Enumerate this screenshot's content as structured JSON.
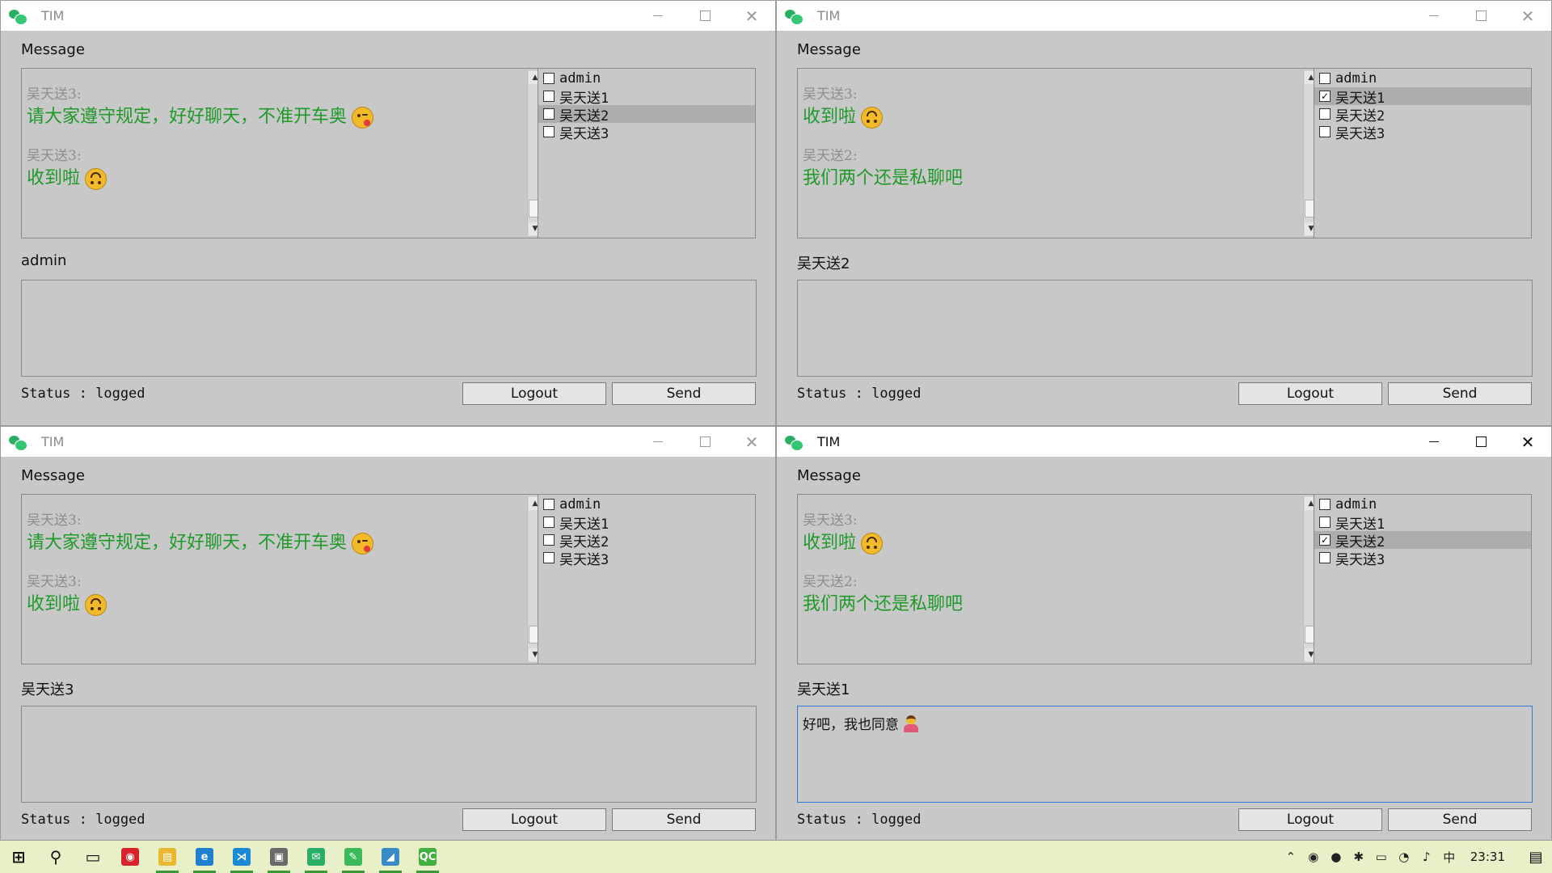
{
  "colors": {
    "window_bg": "#c8c8c8",
    "message_text": "#1f9a2a",
    "sender_text": "#8e8e8e",
    "selected_row": "#adadad",
    "focus_border": "#3078d4",
    "taskbar_bg": "#e8f0c8"
  },
  "windows": [
    {
      "title": "TIM",
      "active": false,
      "message_group_label": "Message",
      "messages": [
        {
          "sender": "吴天送3:",
          "text": "请大家遵守规定，好好聊天，不准开车奥",
          "emoji": "wink-kiss-emoji"
        },
        {
          "sender": "吴天送3:",
          "text": "收到啦",
          "emoji": "upside-down-smile-emoji"
        }
      ],
      "users": [
        {
          "name": "admin",
          "checked": false,
          "selected": false
        },
        {
          "name": "吴天送1",
          "checked": false,
          "selected": false
        },
        {
          "name": "吴天送2",
          "checked": false,
          "selected": true
        },
        {
          "name": "吴天送3",
          "checked": false,
          "selected": false
        }
      ],
      "input_group_label": "admin",
      "input_value": "",
      "status_label": "Status : logged",
      "logout_label": "Logout",
      "send_label": "Send"
    },
    {
      "title": "TIM",
      "active": false,
      "message_group_label": "Message",
      "messages": [
        {
          "sender": "吴天送3:",
          "text": "收到啦",
          "emoji": "upside-down-smile-emoji"
        },
        {
          "sender": "吴天送2:",
          "text": "我们两个还是私聊吧",
          "emoji": ""
        }
      ],
      "users": [
        {
          "name": "admin",
          "checked": false,
          "selected": false
        },
        {
          "name": "吴天送1",
          "checked": true,
          "selected": true
        },
        {
          "name": "吴天送2",
          "checked": false,
          "selected": false
        },
        {
          "name": "吴天送3",
          "checked": false,
          "selected": false
        }
      ],
      "input_group_label": "吴天送2",
      "input_value": "",
      "status_label": "Status : logged",
      "logout_label": "Logout",
      "send_label": "Send"
    },
    {
      "title": "TIM",
      "active": false,
      "message_group_label": "Message",
      "messages": [
        {
          "sender": "吴天送3:",
          "text": "请大家遵守规定，好好聊天，不准开车奥",
          "emoji": "wink-kiss-emoji"
        },
        {
          "sender": "吴天送3:",
          "text": "收到啦",
          "emoji": "upside-down-smile-emoji"
        }
      ],
      "users": [
        {
          "name": "admin",
          "checked": false,
          "selected": false
        },
        {
          "name": "吴天送1",
          "checked": false,
          "selected": false
        },
        {
          "name": "吴天送2",
          "checked": false,
          "selected": false
        },
        {
          "name": "吴天送3",
          "checked": false,
          "selected": false
        }
      ],
      "input_group_label": "吴天送3",
      "input_value": "",
      "status_label": "Status : logged",
      "logout_label": "Logout",
      "send_label": "Send"
    },
    {
      "title": "TIM",
      "active": true,
      "message_group_label": "Message",
      "messages": [
        {
          "sender": "吴天送3:",
          "text": "收到啦",
          "emoji": "upside-down-smile-emoji"
        },
        {
          "sender": "吴天送2:",
          "text": "我们两个还是私聊吧",
          "emoji": ""
        }
      ],
      "users": [
        {
          "name": "admin",
          "checked": false,
          "selected": false
        },
        {
          "name": "吴天送1",
          "checked": false,
          "selected": false
        },
        {
          "name": "吴天送2",
          "checked": true,
          "selected": true
        },
        {
          "name": "吴天送3",
          "checked": false,
          "selected": false
        }
      ],
      "input_group_label": "吴天送1",
      "input_value": "好吧，我也同意",
      "input_emoji": "person-raising-hand-emoji",
      "status_label": "Status : logged",
      "logout_label": "Logout",
      "send_label": "Send"
    }
  ],
  "taskbar": {
    "apps": [
      {
        "icon": "windows-start-icon",
        "glyph": "⊞",
        "color": "#111111",
        "running": false
      },
      {
        "icon": "search-icon",
        "glyph": "⚲",
        "color": "#111111",
        "running": false
      },
      {
        "icon": "task-view-icon",
        "glyph": "▭",
        "color": "#111111",
        "running": false
      },
      {
        "icon": "netease-music-icon",
        "glyph": "◉",
        "color": "#d8232a",
        "running": false
      },
      {
        "icon": "file-explorer-icon",
        "glyph": "▤",
        "color": "#e8b830",
        "running": true
      },
      {
        "icon": "edge-browser-icon",
        "glyph": "e",
        "color": "#1f7fd0",
        "running": true
      },
      {
        "icon": "visual-studio-code-icon",
        "glyph": "⋊",
        "color": "#1a8ad4",
        "running": true
      },
      {
        "icon": "terminal-app-icon",
        "glyph": "▣",
        "color": "#6a6a6a",
        "running": true
      },
      {
        "icon": "wechat-icon",
        "glyph": "✉",
        "color": "#2aae67",
        "running": true
      },
      {
        "icon": "wechat-dev-tools-icon",
        "glyph": "✎",
        "color": "#3aba5a",
        "running": true
      },
      {
        "icon": "network-tool-icon",
        "glyph": "◢",
        "color": "#3a8ac8",
        "running": true
      },
      {
        "icon": "qt-creator-icon",
        "glyph": "QC",
        "color": "#41b041",
        "running": true
      }
    ],
    "tray": [
      {
        "icon": "show-hidden-icons-chevron-icon",
        "glyph": "⌃"
      },
      {
        "icon": "netease-tray-icon",
        "glyph": "◉"
      },
      {
        "icon": "wechat-tray-icon",
        "glyph": "●"
      },
      {
        "icon": "bluetooth-icon",
        "glyph": "✱"
      },
      {
        "icon": "battery-icon",
        "glyph": "▭"
      },
      {
        "icon": "wifi-icon",
        "glyph": "◔"
      },
      {
        "icon": "volume-icon",
        "glyph": "♪"
      }
    ],
    "ime_label": "中",
    "clock": "23:31",
    "notification_icon": "notification-center-icon"
  }
}
